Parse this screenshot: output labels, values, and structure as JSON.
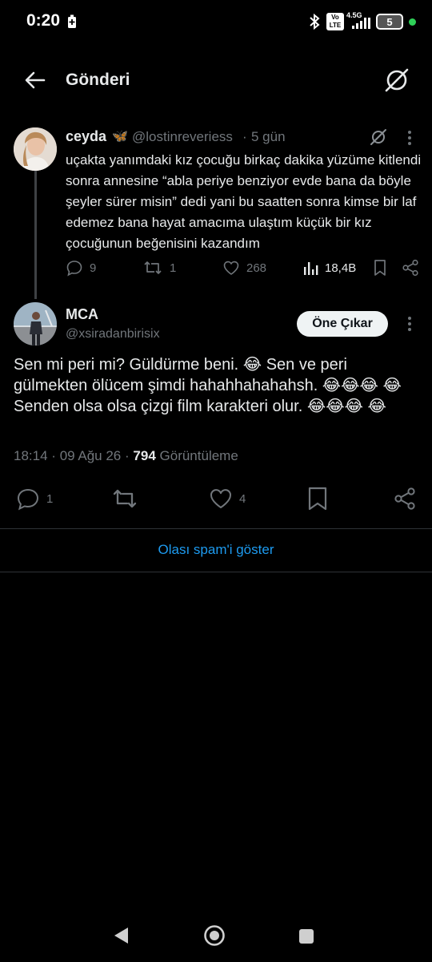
{
  "status_bar": {
    "time": "0:20",
    "network": "4.5G",
    "volte": "Vo LTE",
    "battery": "5"
  },
  "header": {
    "title": "Gönderi"
  },
  "parent_tweet": {
    "name": "ceyda",
    "badge": "🦋",
    "handle": "@lostinreveriess",
    "separator": "·",
    "time": "5 gün",
    "text": "uçakta yanımdaki kız çocuğu birkaç dakika yüzüme kitlendi sonra annesine “abla periye benziyor evde bana da böyle şeyler sürer misin” dedi yani bu saatten sonra kimse bir laf edemez bana hayat amacıma ulaştım küçük bir kız çocuğunun beğenisini kazandım",
    "replies": "9",
    "retweets": "1",
    "likes": "268",
    "views": "18,4B"
  },
  "main_tweet": {
    "name": "MCA",
    "handle": "@xsiradanbirisix",
    "feature_button": "Öne Çıkar",
    "text": "Sen mi peri mi? Güldürme beni. 😂  Sen ve peri gülmekten ölücem şimdi hahahhahahahsh. 😂😂😂 😂 Senden olsa olsa çizgi film karakteri olur. 😂😂😂 😂",
    "time": "18:14",
    "separator": "·",
    "date": "09 Ağu 26",
    "views_count": "794",
    "views_label": "Görüntüleme",
    "replies": "1",
    "likes": "4"
  },
  "spam_link": "Olası spam'i göster",
  "colors": {
    "background": "#000000",
    "text": "#e7e9ea",
    "muted": "#71767b",
    "accent": "#1d9bf0",
    "divider": "#2f3336"
  }
}
